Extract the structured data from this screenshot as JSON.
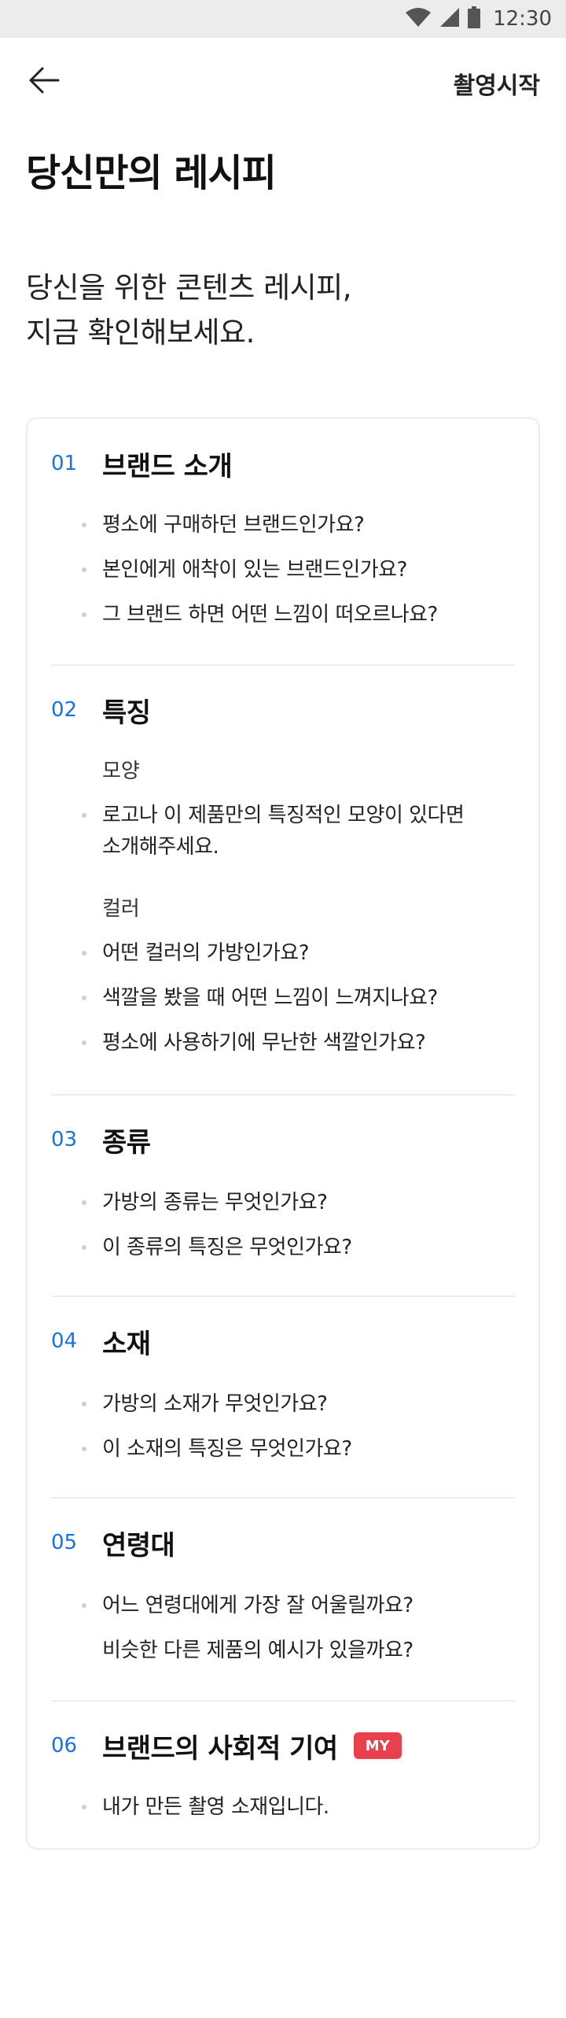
{
  "status": {
    "time": "12:30"
  },
  "header": {
    "start_label": "촬영시작"
  },
  "page": {
    "title": "당신만의 레시피"
  },
  "intro": {
    "line1": "당신을 위한 콘텐츠 레시피,",
    "line2": "지금 확인해보세요."
  },
  "sections": [
    {
      "num": "01",
      "title": "브랜드 소개",
      "items": [
        "평소에 구매하던 브랜드인가요?",
        "본인에게 애착이 있는 브랜드인가요?",
        "그 브랜드 하면 어떤 느낌이 떠오르나요?"
      ]
    },
    {
      "num": "02",
      "title": "특징",
      "sub1": "모양",
      "item1_line1": "로고나 이 제품만의 특징적인 모양이 있다면",
      "item1_line2": "소개해주세요.",
      "sub2": "컬러",
      "items": [
        "어떤 컬러의 가방인가요?",
        "색깔을 봤을 때 어떤 느낌이 느껴지나요?",
        "평소에 사용하기에 무난한 색깔인가요?"
      ]
    },
    {
      "num": "03",
      "title": "종류",
      "items": [
        "가방의 종류는 무엇인가요?",
        "이 종류의 특징은 무엇인가요?"
      ]
    },
    {
      "num": "04",
      "title": "소재",
      "items": [
        "가방의 소재가 무엇인가요?",
        "이 소재의 특징은 무엇인가요?"
      ]
    },
    {
      "num": "05",
      "title": "연령대",
      "items": [
        "어느 연령대에게 가장 잘 어울릴까요?",
        "비슷한 다른 제품의 예시가 있을까요?"
      ]
    },
    {
      "num": "06",
      "title": "브랜드의 사회적 기여",
      "badge": "MY",
      "items": [
        "내가 만든 촬영 소재입니다."
      ]
    }
  ],
  "colors": {
    "accent": "#1673e6",
    "badge": "#e8404d",
    "divider": "#ececec"
  },
  "icons": {
    "back": "arrow-left-icon",
    "wifi": "wifi-icon",
    "signal": "signal-icon",
    "battery": "battery-icon"
  }
}
